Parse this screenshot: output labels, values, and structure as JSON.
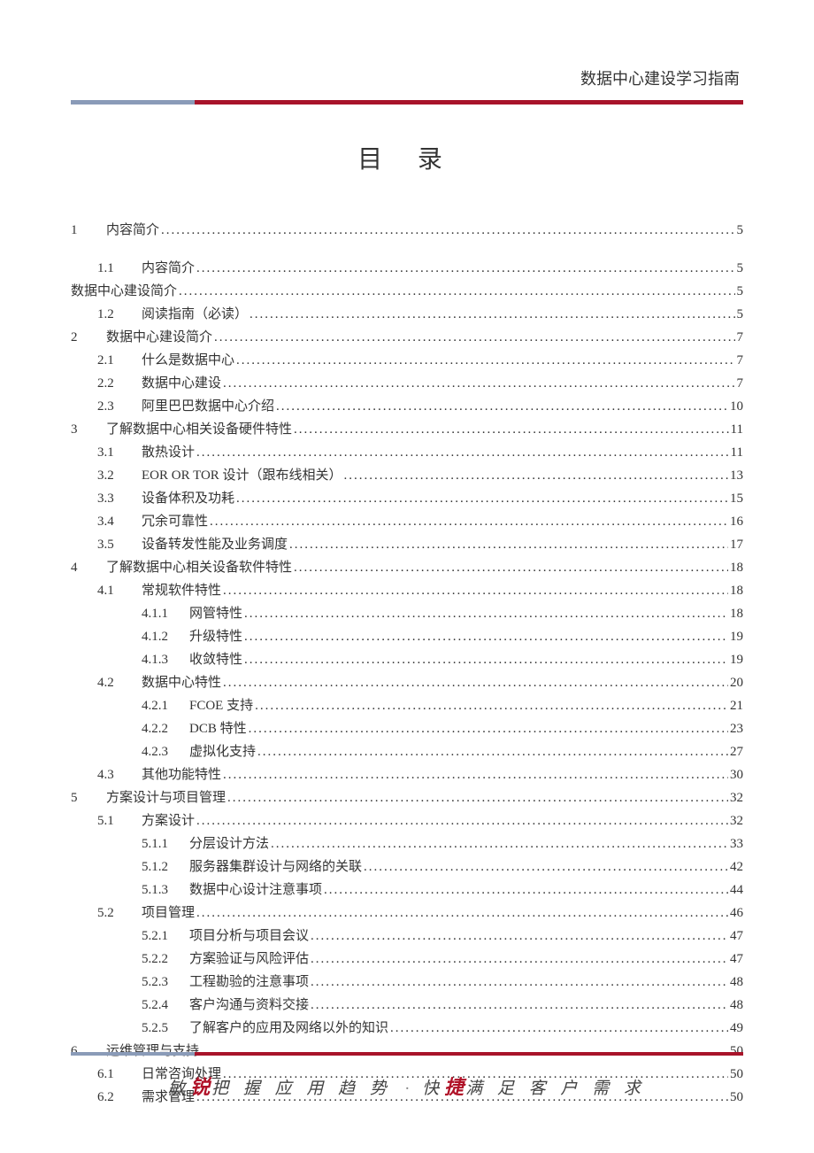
{
  "header": {
    "title": "数据中心建设学习指南"
  },
  "toc_title": "目 录",
  "toc": [
    {
      "lvl": 1,
      "gap": false,
      "num": "1",
      "title": "内容简介",
      "page": "5"
    },
    {
      "lvl": 2,
      "gap": true,
      "num": "1.1",
      "title": "内容简介",
      "page": "5"
    },
    {
      "lvl": 0,
      "num": "",
      "title": "数据中心建设简介",
      "page": "5"
    },
    {
      "lvl": 2,
      "num": "1.2",
      "title": "阅读指南（必读）",
      "page": "5"
    },
    {
      "lvl": 1,
      "num": "2",
      "title": "数据中心建设简介",
      "page": "7"
    },
    {
      "lvl": 2,
      "num": "2.1",
      "title": "什么是数据中心",
      "page": "7"
    },
    {
      "lvl": 2,
      "num": "2.2",
      "title": "数据中心建设",
      "page": "7"
    },
    {
      "lvl": 2,
      "num": "2.3",
      "title": "阿里巴巴数据中心介绍",
      "page": "10"
    },
    {
      "lvl": 1,
      "num": "3",
      "title": "了解数据中心相关设备硬件特性",
      "page": "11"
    },
    {
      "lvl": 2,
      "num": "3.1",
      "title": "散热设计",
      "page": "11"
    },
    {
      "lvl": 2,
      "num": "3.2",
      "title": "EOR OR TOR 设计（跟布线相关）",
      "page": "13"
    },
    {
      "lvl": 2,
      "num": "3.3",
      "title": "设备体积及功耗",
      "page": "15"
    },
    {
      "lvl": 2,
      "num": "3.4",
      "title": "冗余可靠性",
      "page": "16"
    },
    {
      "lvl": 2,
      "num": "3.5",
      "title": "设备转发性能及业务调度",
      "page": "17"
    },
    {
      "lvl": 1,
      "num": "4",
      "title": "了解数据中心相关设备软件特性",
      "page": "18"
    },
    {
      "lvl": 2,
      "num": "4.1",
      "title": "常规软件特性",
      "page": "18"
    },
    {
      "lvl": 3,
      "num": "4.1.1",
      "title": "网管特性",
      "page": "18"
    },
    {
      "lvl": 3,
      "num": "4.1.2",
      "title": "升级特性",
      "page": "19"
    },
    {
      "lvl": 3,
      "num": "4.1.3",
      "title": "收敛特性",
      "page": "19"
    },
    {
      "lvl": 2,
      "num": "4.2",
      "title": "数据中心特性",
      "page": "20"
    },
    {
      "lvl": 3,
      "num": "4.2.1",
      "title": "FCOE 支持",
      "page": "21"
    },
    {
      "lvl": 3,
      "num": "4.2.2",
      "title": "DCB 特性",
      "page": "23"
    },
    {
      "lvl": 3,
      "num": "4.2.3",
      "title": "虚拟化支持",
      "page": "27"
    },
    {
      "lvl": 2,
      "num": "4.3",
      "title": "其他功能特性",
      "page": "30"
    },
    {
      "lvl": 1,
      "num": "5",
      "title": "方案设计与项目管理",
      "page": "32"
    },
    {
      "lvl": 2,
      "num": "5.1",
      "title": "方案设计",
      "page": "32"
    },
    {
      "lvl": 3,
      "num": "5.1.1",
      "title": "分层设计方法",
      "page": "33"
    },
    {
      "lvl": 3,
      "num": "5.1.2",
      "title": "服务器集群设计与网络的关联",
      "page": "42"
    },
    {
      "lvl": 3,
      "num": "5.1.3",
      "title": "数据中心设计注意事项",
      "page": "44"
    },
    {
      "lvl": 2,
      "num": "5.2",
      "title": "项目管理",
      "page": "46"
    },
    {
      "lvl": 3,
      "num": "5.2.1",
      "title": "项目分析与项目会议",
      "page": "47"
    },
    {
      "lvl": 3,
      "num": "5.2.2",
      "title": "方案验证与风险评估",
      "page": "47"
    },
    {
      "lvl": 3,
      "num": "5.2.3",
      "title": "工程勘验的注意事项",
      "page": "48"
    },
    {
      "lvl": 3,
      "num": "5.2.4",
      "title": "客户沟通与资料交接",
      "page": "48"
    },
    {
      "lvl": 3,
      "num": "5.2.5",
      "title": "了解客户的应用及网络以外的知识",
      "page": "49"
    },
    {
      "lvl": 1,
      "num": "6",
      "title": "运维管理与支持",
      "page": "50"
    },
    {
      "lvl": 2,
      "num": "6.1",
      "title": "日常咨询处理",
      "page": "50"
    },
    {
      "lvl": 2,
      "num": "6.2",
      "title": "需求管理",
      "page": "50"
    }
  ],
  "footer": {
    "p1a": "敏",
    "p1em": "锐",
    "p1b": "把 握 应 用 趋 势",
    "sep": "·",
    "p2a": "快",
    "p2em": "捷",
    "p2b": "满 足 客 户 需 求"
  }
}
